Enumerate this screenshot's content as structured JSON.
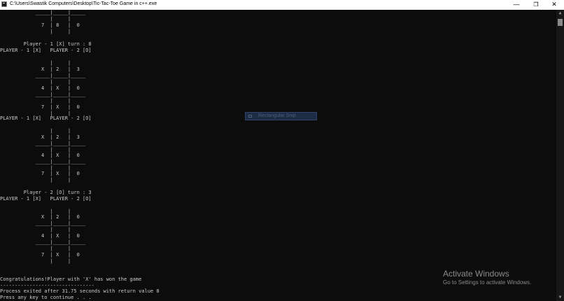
{
  "window": {
    "title": "C:\\Users\\Swastik Computers\\Desktop\\Tic-Tac-Toe Game in c++.exe",
    "minimize_glyph": "—",
    "restore_glyph": "❐",
    "close_glyph": "✕"
  },
  "console": {
    "lines": [
      "            _____|_____|_____",
      "                 |     |",
      "              7  | 8   |  0",
      "                 |     |",
      "",
      "        Player - 1 [X] turn : 8",
      "PLAYER - 1 [X]   PLAYER - 2 [O]",
      "",
      "                 |     |",
      "              X  | 2   |  3",
      "            _____|_____|_____",
      "                 |     |",
      "              4  | X   |  0",
      "            _____|_____|_____",
      "                 |     |",
      "              7  | X   |  0",
      "                 |     |",
      "PLAYER - 1 [X]   PLAYER - 2 [O]",
      "",
      "                 |     |",
      "              X  | 2   |  3",
      "            _____|_____|_____",
      "                 |     |",
      "              4  | X   |  0",
      "            _____|_____|_____",
      "                 |     |",
      "              7  | X   |  0",
      "                 |     |",
      "",
      "",
      "        Player - 2 [O] turn : 3",
      "PLAYER - 1 [X]   PLAYER - 2 [O]",
      "",
      "                 |     |",
      "              X  | 2   |  0",
      "            _____|_____|_____",
      "                 |     |",
      "              4  | X   |  0",
      "            _____|_____|_____",
      "                 |     |",
      "              7  | X   |  0",
      "                 |     |",
      "",
      "",
      "Congratulations!Player with 'X' has won the game",
      "--------------------------------",
      "Process exited after 31.75 seconds with return value 0",
      "Press any key to continue . . ."
    ]
  },
  "overlay": {
    "snip_label": "Rectangular Snip"
  },
  "watermark": {
    "title": "Activate Windows",
    "subtitle": "Go to Settings to activate Windows."
  },
  "scrollbar": {
    "up_glyph": "▲",
    "down_glyph": "▼"
  },
  "colors": {
    "background": "#0c0c0c",
    "text": "#cccccc",
    "titlebar": "#ffffff"
  }
}
